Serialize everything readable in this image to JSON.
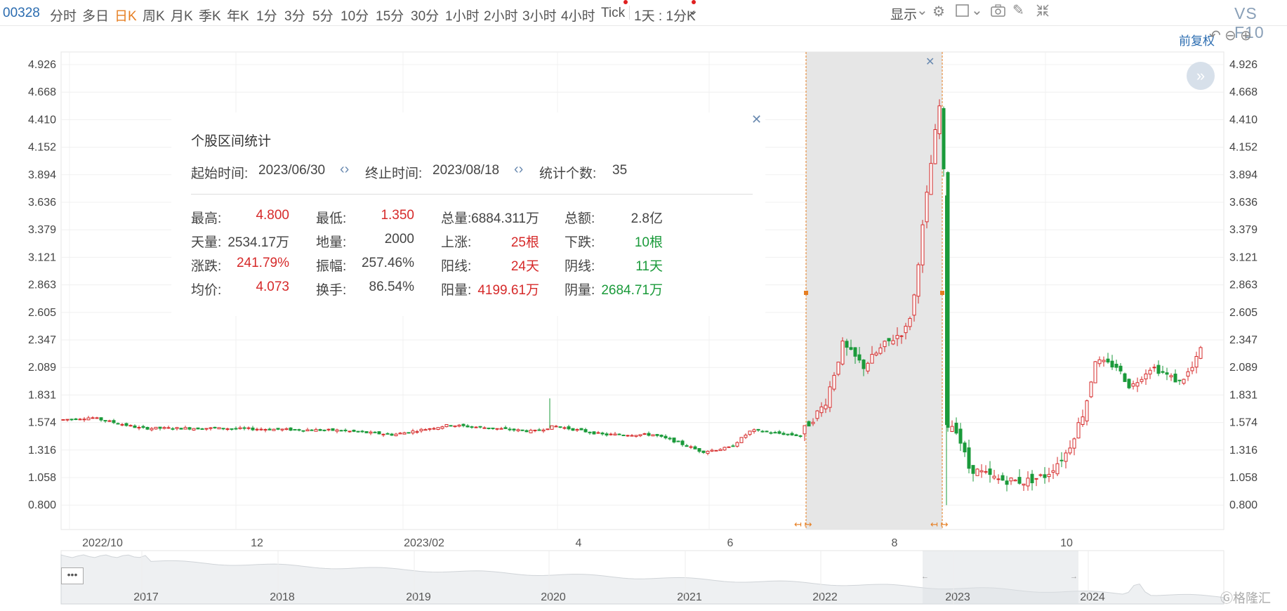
{
  "toolbar": {
    "code": "00328",
    "periods": [
      "分时",
      "多日",
      "日K",
      "周K",
      "月K",
      "季K",
      "年K",
      "1分",
      "3分",
      "5分",
      "10分",
      "15分",
      "30分",
      "1小时",
      "2小时",
      "3小时",
      "4小时",
      "Tick"
    ],
    "active_period": "日K",
    "multi_period_label": "1天 : 1分K",
    "display_label": "显示",
    "vs_label": "VS F10"
  },
  "adjust_label": "前复权",
  "y_axis": [
    "4.926",
    "4.668",
    "4.410",
    "4.152",
    "3.894",
    "3.636",
    "3.379",
    "3.121",
    "2.863",
    "2.605",
    "2.347",
    "2.089",
    "1.831",
    "1.574",
    "1.316",
    "1.058",
    "0.800"
  ],
  "x_axis": [
    "2022/10",
    "12",
    "2023/02",
    "4",
    "6",
    "8",
    "10"
  ],
  "navigator_years": [
    "2017",
    "2018",
    "2019",
    "2020",
    "2021",
    "2022",
    "2023",
    "2024"
  ],
  "stats": {
    "title": "个股区间统计",
    "start_label": "起始时间:",
    "start_value": "2023/06/30",
    "end_label": "终止时间:",
    "end_value": "2023/08/18",
    "count_label": "统计个数:",
    "count_value": "35",
    "rows": [
      [
        [
          "最高:",
          "4.800",
          "red"
        ],
        [
          "最低:",
          "1.350",
          "red"
        ],
        [
          "总量:",
          "6884.311万",
          "neutral"
        ],
        [
          "总额:",
          "2.8亿",
          "neutral"
        ]
      ],
      [
        [
          "天量:",
          "2534.17万",
          "neutral"
        ],
        [
          "地量:",
          "2000",
          "neutral"
        ],
        [
          "上涨:",
          "25根",
          "red"
        ],
        [
          "下跌:",
          "10根",
          "green"
        ]
      ],
      [
        [
          "涨跌:",
          "241.79%",
          "red"
        ],
        [
          "振幅:",
          "257.46%",
          "neutral"
        ],
        [
          "阳线:",
          "24天",
          "red"
        ],
        [
          "阴线:",
          "11天",
          "green"
        ]
      ],
      [
        [
          "均价:",
          "4.073",
          "red"
        ],
        [
          "换手:",
          "86.54%",
          "neutral"
        ],
        [
          "阳量:",
          "4199.61万",
          "red"
        ],
        [
          "阴量:",
          "2684.71万",
          "green"
        ]
      ]
    ]
  },
  "chart_data": {
    "type": "candlestick",
    "series_summary": [
      {
        "period": "2022/09-2023/05",
        "approx_close_range": [
          1.45,
          1.62
        ]
      },
      {
        "period": "2023/03 spike",
        "high": 1.8
      },
      {
        "period": "2023/05-06",
        "approx_close_range": [
          1.25,
          1.55
        ]
      },
      {
        "period": "2023/07",
        "approx_close_range": [
          2.0,
          2.8
        ]
      },
      {
        "period": "2023/08 peak",
        "high": 4.8
      },
      {
        "period": "2023/08 drop",
        "low": 0.8
      },
      {
        "period": "2023/09",
        "approx_close_range": [
          0.95,
          1.1
        ]
      },
      {
        "period": "2023/10-11",
        "approx_close_range": [
          1.7,
          2.35
        ]
      }
    ],
    "selected_range": {
      "start": "2023/06/30",
      "end": "2023/08/18"
    },
    "ylim": [
      0.8,
      4.926
    ]
  },
  "colors": {
    "up": "#d62a2a",
    "down": "#1a9a3a",
    "selection": "#e6e6e6",
    "accent": "#e67e22"
  }
}
